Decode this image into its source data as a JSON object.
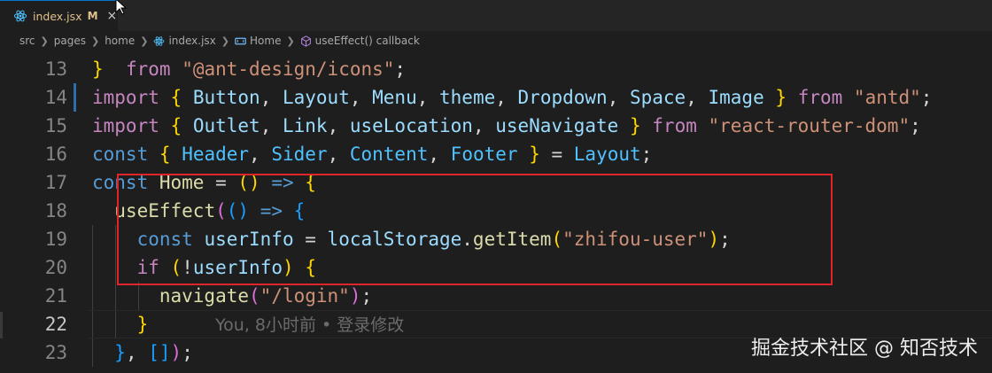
{
  "tab": {
    "filename": "index.jsx",
    "modified_flag": "M",
    "close_glyph": "×"
  },
  "breadcrumb": [
    "src",
    "pages",
    "home",
    "index.jsx",
    "Home",
    "useEffect() callback"
  ],
  "lines": [
    {
      "number": "13",
      "tokens": [
        [
          "b1",
          "}"
        ],
        [
          "",
          "  "
        ],
        [
          "kw",
          "from"
        ],
        [
          "",
          " "
        ],
        [
          "str",
          "\"@ant-design/icons\""
        ],
        [
          "",
          ";"
        ]
      ]
    },
    {
      "number": "14",
      "tokens": [
        [
          "kw",
          "import"
        ],
        [
          "",
          " "
        ],
        [
          "b1",
          "{"
        ],
        [
          "",
          " "
        ],
        [
          "var",
          "Button"
        ],
        [
          "",
          ", "
        ],
        [
          "var",
          "Layout"
        ],
        [
          "",
          ", "
        ],
        [
          "var",
          "Menu"
        ],
        [
          "",
          ", "
        ],
        [
          "var",
          "theme"
        ],
        [
          "",
          ", "
        ],
        [
          "var",
          "Dropdown"
        ],
        [
          "",
          ", "
        ],
        [
          "var",
          "Space"
        ],
        [
          "",
          ", "
        ],
        [
          "var",
          "Image"
        ],
        [
          "",
          " "
        ],
        [
          "b1",
          "}"
        ],
        [
          "",
          " "
        ],
        [
          "kw",
          "from"
        ],
        [
          "",
          " "
        ],
        [
          "str",
          "\"antd\""
        ],
        [
          "",
          ";"
        ]
      ]
    },
    {
      "number": "15",
      "tokens": [
        [
          "kw",
          "import"
        ],
        [
          "",
          " "
        ],
        [
          "b1",
          "{"
        ],
        [
          "",
          " "
        ],
        [
          "var",
          "Outlet"
        ],
        [
          "",
          ", "
        ],
        [
          "var",
          "Link"
        ],
        [
          "",
          ", "
        ],
        [
          "var",
          "useLocation"
        ],
        [
          "",
          ", "
        ],
        [
          "var",
          "useNavigate"
        ],
        [
          "",
          " "
        ],
        [
          "b1",
          "}"
        ],
        [
          "",
          " "
        ],
        [
          "kw",
          "from"
        ],
        [
          "",
          " "
        ],
        [
          "str",
          "\"react-router-dom\""
        ],
        [
          "",
          ";"
        ]
      ]
    },
    {
      "number": "16",
      "tokens": [
        [
          "kw2",
          "const"
        ],
        [
          "",
          " "
        ],
        [
          "b1",
          "{"
        ],
        [
          "",
          " "
        ],
        [
          "cls",
          "Header"
        ],
        [
          "",
          ", "
        ],
        [
          "cls",
          "Sider"
        ],
        [
          "",
          ", "
        ],
        [
          "cls",
          "Content"
        ],
        [
          "",
          ", "
        ],
        [
          "cls",
          "Footer"
        ],
        [
          "",
          " "
        ],
        [
          "b1",
          "}"
        ],
        [
          "",
          " = "
        ],
        [
          "cls",
          "Layout"
        ],
        [
          "",
          ";"
        ]
      ]
    },
    {
      "number": "17",
      "tokens": [
        [
          "kw2",
          "const"
        ],
        [
          "",
          " "
        ],
        [
          "fn",
          "Home"
        ],
        [
          "",
          " = "
        ],
        [
          "b1",
          "()"
        ],
        [
          "",
          " "
        ],
        [
          "kw2",
          "=>"
        ],
        [
          "",
          " "
        ],
        [
          "b1",
          "{"
        ]
      ]
    },
    {
      "number": "18",
      "tokens": [
        [
          "",
          "  "
        ],
        [
          "fn",
          "useEffect"
        ],
        [
          "b2",
          "("
        ],
        [
          "b3",
          "()"
        ],
        [
          "",
          " "
        ],
        [
          "kw2",
          "=>"
        ],
        [
          "",
          " "
        ],
        [
          "b3",
          "{"
        ]
      ]
    },
    {
      "number": "19",
      "tokens": [
        [
          "",
          "    "
        ],
        [
          "kw2",
          "const"
        ],
        [
          "",
          " "
        ],
        [
          "var",
          "userInfo"
        ],
        [
          "",
          " = "
        ],
        [
          "var",
          "localStorage"
        ],
        [
          "",
          "."
        ],
        [
          "fn",
          "getItem"
        ],
        [
          "b1",
          "("
        ],
        [
          "str",
          "\"zhifou-user\""
        ],
        [
          "b1",
          ")"
        ],
        [
          "",
          ";"
        ]
      ]
    },
    {
      "number": "20",
      "tokens": [
        [
          "",
          "    "
        ],
        [
          "kw",
          "if"
        ],
        [
          "",
          " "
        ],
        [
          "b1",
          "("
        ],
        [
          "",
          "!"
        ],
        [
          "var",
          "userInfo"
        ],
        [
          "b1",
          ")"
        ],
        [
          "",
          " "
        ],
        [
          "b1",
          "{"
        ]
      ]
    },
    {
      "number": "21",
      "tokens": [
        [
          "",
          "      "
        ],
        [
          "fn",
          "navigate"
        ],
        [
          "b2",
          "("
        ],
        [
          "str",
          "\"/login\""
        ],
        [
          "b2",
          ")"
        ],
        [
          "",
          ";"
        ]
      ]
    },
    {
      "number": "22",
      "tokens": [
        [
          "",
          "    "
        ],
        [
          "b1",
          "}"
        ]
      ]
    },
    {
      "number": "23",
      "tokens": [
        [
          "",
          "  "
        ],
        [
          "b3",
          "}"
        ],
        [
          "",
          ", "
        ],
        [
          "b3",
          "[]"
        ],
        [
          "b2",
          ")"
        ],
        [
          "",
          ";"
        ]
      ]
    }
  ],
  "blame_text": "You, 8小时前 • 登录修改",
  "watermark": "掘金技术社区 @ 知否技术",
  "colors": {
    "highlight_box": "#e0252a",
    "tab_modified": "#e2c08d",
    "git_change_bar": "#2d6ea8"
  }
}
